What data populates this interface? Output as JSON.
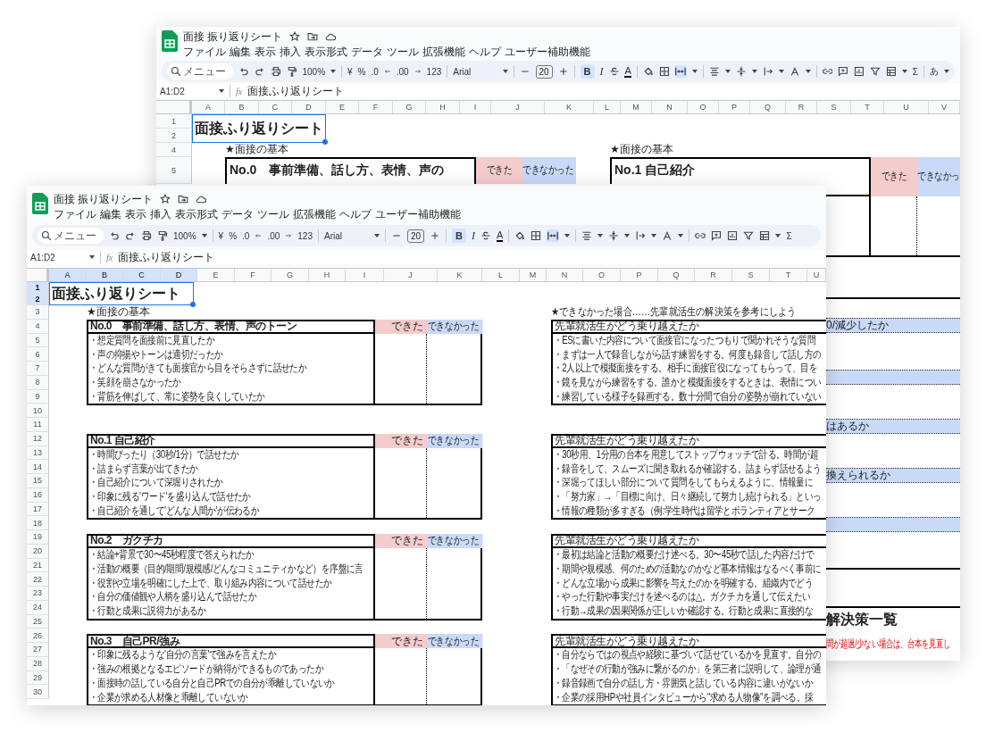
{
  "windows": [
    {
      "title": "面接 振り返りシート",
      "menu": [
        "ファイル",
        "編集",
        "表示",
        "挿入",
        "表示形式",
        "データ",
        "ツール",
        "拡張機能",
        "ヘルプ",
        "ユーザー補助機能"
      ],
      "toolbar": {
        "search_placeholder": "メニュー",
        "zoom": "100%",
        "currency": "¥",
        "percent": "%",
        "decimal_less": ".0",
        "decimal_more": ".00",
        "number_format": "123",
        "font": "Arial",
        "font_size": "20",
        "bold": "B",
        "italic": "I",
        "text_color": "A",
        "functions": "Σ",
        "input_tools": "あ",
        "bold_selected": true,
        "merge_selected": true
      },
      "name_box": "A1:D2",
      "fx": "fx",
      "formula": "面接ふり返りシート",
      "columns": [
        {
          "label": "A",
          "selected": false
        },
        {
          "label": "B",
          "selected": false
        },
        {
          "label": "C",
          "selected": false
        },
        {
          "label": "D",
          "selected": false
        },
        {
          "label": "E",
          "selected": false
        },
        {
          "label": "F",
          "selected": false
        },
        {
          "label": "G",
          "selected": false
        },
        {
          "label": "H",
          "selected": false
        },
        {
          "label": "I",
          "selected": false
        },
        {
          "label": "J",
          "selected": false
        },
        {
          "label": "K",
          "selected": false
        },
        {
          "label": "L",
          "selected": false
        },
        {
          "label": "M",
          "selected": false
        },
        {
          "label": "N",
          "selected": false
        },
        {
          "label": "O",
          "selected": false
        },
        {
          "label": "P",
          "selected": false
        },
        {
          "label": "Q",
          "selected": false
        },
        {
          "label": "R",
          "selected": false
        },
        {
          "label": "S",
          "selected": false
        },
        {
          "label": "T",
          "selected": false
        },
        {
          "label": "U",
          "selected": false
        },
        {
          "label": "V",
          "selected": false
        }
      ],
      "rows": [
        {
          "label": "1",
          "selected": false
        },
        {
          "label": "2",
          "selected": false
        },
        {
          "label": "4",
          "selected": false
        },
        {
          "label": "5",
          "selected": false
        }
      ],
      "sheet": {
        "title": "面接ふり返りシート",
        "labels": [
          "★面接の基本",
          "★面接の基本"
        ],
        "blocks": [
          {
            "heading": "No.0　事前準備、話し方、表情、声の",
            "done": "できた",
            "not_done": "できなかった"
          },
          {
            "heading": "No.1  自己紹介",
            "done": "できた",
            "not_done": "できなかっ"
          }
        ],
        "bands": [
          {
            "kind": "band",
            "text": "0/減少したか"
          },
          {
            "kind": "band"
          },
          {
            "kind": "band",
            "text": "はあるか"
          },
          {
            "kind": "band",
            "text": "換えられるか"
          },
          {
            "kind": "band"
          }
        ],
        "summary_heading": "解決策一覧",
        "note": "間が超過/少ない場合は、台本を見直し"
      }
    },
    {
      "title": "面接 振り返りシート",
      "menu": [
        "ファイル",
        "編集",
        "表示",
        "挿入",
        "表示形式",
        "データ",
        "ツール",
        "拡張機能",
        "ヘルプ",
        "ユーザー補助機能"
      ],
      "toolbar": {
        "search_placeholder": "メニュー",
        "zoom": "100%",
        "currency": "¥",
        "percent": "%",
        "decimal_less": ".0",
        "decimal_more": ".00",
        "number_format": "123",
        "font": "Arial",
        "font_size": "20",
        "bold": "B",
        "italic": "I",
        "text_color": "A",
        "functions": "Σ",
        "bold_selected": true,
        "merge_selected": true
      },
      "name_box": "A1:D2",
      "fx": "fx",
      "formula": "面接ふり返りシート",
      "columns": [
        {
          "label": "A",
          "selected": true
        },
        {
          "label": "B",
          "selected": true
        },
        {
          "label": "C",
          "selected": true
        },
        {
          "label": "D",
          "selected": true
        },
        {
          "label": "E",
          "selected": false
        },
        {
          "label": "F",
          "selected": false
        },
        {
          "label": "G",
          "selected": false
        },
        {
          "label": "H",
          "selected": false
        },
        {
          "label": "I",
          "selected": false
        },
        {
          "label": "J",
          "selected": false
        },
        {
          "label": "K",
          "selected": false
        },
        {
          "label": "L",
          "selected": false
        },
        {
          "label": "M",
          "selected": false
        },
        {
          "label": "N",
          "selected": false
        },
        {
          "label": "O",
          "selected": false
        },
        {
          "label": "P",
          "selected": false
        },
        {
          "label": "Q",
          "selected": false
        },
        {
          "label": "R",
          "selected": false
        },
        {
          "label": "S",
          "selected": false
        },
        {
          "label": "T",
          "selected": false
        },
        {
          "label": "U",
          "selected": false
        }
      ],
      "rows": [
        {
          "label": "1",
          "selected": true
        },
        {
          "label": "2",
          "selected": true
        },
        {
          "label": "3",
          "selected": false
        },
        {
          "label": "4",
          "selected": false
        },
        {
          "label": "5",
          "selected": false
        },
        {
          "label": "6",
          "selected": false
        },
        {
          "label": "7",
          "selected": false
        },
        {
          "label": "8",
          "selected": false
        },
        {
          "label": "9",
          "selected": false
        },
        {
          "label": "10",
          "selected": false
        },
        {
          "label": "11",
          "selected": false
        },
        {
          "label": "12",
          "selected": false
        },
        {
          "label": "13",
          "selected": false
        },
        {
          "label": "14",
          "selected": false
        },
        {
          "label": "15",
          "selected": false
        },
        {
          "label": "16",
          "selected": false
        },
        {
          "label": "17",
          "selected": false
        },
        {
          "label": "18",
          "selected": false
        },
        {
          "label": "19",
          "selected": false
        },
        {
          "label": "20",
          "selected": false
        },
        {
          "label": "21",
          "selected": false
        },
        {
          "label": "22",
          "selected": false
        },
        {
          "label": "23",
          "selected": false
        },
        {
          "label": "24",
          "selected": false
        },
        {
          "label": "25",
          "selected": false
        },
        {
          "label": "26",
          "selected": false
        },
        {
          "label": "27",
          "selected": false
        },
        {
          "label": "28",
          "selected": false
        },
        {
          "label": "29",
          "selected": false
        },
        {
          "label": "30",
          "selected": false
        }
      ],
      "sheet": {
        "title": "面接ふり返りシート",
        "label": "★面接の基本",
        "right_label": "★できなかった場合……先輩就活生の解決策を参考にしよう",
        "blocks": [
          {
            "heading": "No.0　事前準備、話し方、表情、声のトーン",
            "done": "できた",
            "not_done": "できなかった",
            "items": [
              "・想定質問を面接前に見直したか",
              "・声の抑揚やトーンは適切だったか",
              "・どんな質問がきても面接官から目をそらさずに話せたか",
              "・笑顔を崩さなかったか",
              "・背筋を伸ばして、常に姿勢を良くしていたか"
            ]
          },
          {
            "heading": "No.1  自己紹介",
            "done": "できた",
            "not_done": "できなかった",
            "items": [
              "・時間ぴったり（30秒/1分）で話せたか",
              "・詰まらず言葉が出てきたか",
              "・自己紹介について深堀りされたか",
              "・印象に残る'ワード'を盛り込んで話せたか",
              "・自己紹介を通して'どんな人間か'が伝わるか"
            ]
          },
          {
            "heading": "No.2　ガクチカ",
            "done": "できた",
            "not_done": "できなかった",
            "items": [
              "・結論+背景で30〜45秒程度で答えられたか",
              "・活動の概要（目的/期間/規模感/どんなコミュニティかなど）を序盤に言",
              "・役割や立場を明確にした上で、取り組み内容について話せたか",
              "・自分の価値観や人柄を盛り込んで話せたか",
              "・行動と成果に説得力があるか"
            ]
          },
          {
            "heading": "No.3　自己PR/強み",
            "done": "できた",
            "not_done": "できなかった",
            "items": [
              "・印象に残るような'自分の言葉'で強みを言えたか",
              "・強みの根拠となるエピソードが納得ができるものであったか",
              "・面接時の話している自分と自己PRでの自分が乖離していないか",
              "・企業が求める人材像と乖離していないか"
            ]
          }
        ],
        "advice": [
          {
            "heading": "先輩就活生がどう乗り越えたか",
            "items": [
              "・ESに書いた内容について面接官になったつもりで聞かれそうな質問",
              "・まずは一人で録音しながら話す練習をする。何度も録音して話し方の",
              "・2人以上で模擬面接をする。相手に面接官役になってもらって、目を",
              "・鏡を見ながら練習をする。誰かと模擬面接をするときは、表情につい",
              "・練習している様子を録画する。数十分間で自分の姿勢が崩れていない"
            ]
          },
          {
            "heading": "先輩就活生がどう乗り越えたか",
            "items": [
              "・30秒用、1分用の台本を用意してストップウォッチで計る。時間が超",
              "・録音をして、スムーズに聞き取れるか確認する。詰まらず話せるよう",
              "・深堀ってほしい部分について質問をしてもらえるように、情報量に",
              "・「努力家」→「目標に向け、日々継続して努力し続けられる」といっ",
              "・情報の種類が多すぎる（例:学生時代は留学とボランティアとサーク"
            ]
          },
          {
            "heading": "先輩就活生がどう乗り越えたか",
            "items": [
              "・最初は結論と活動の概要だけ述べる。30〜45秒で話した内容だけで",
              "・期間や規模感、何のための活動なのかなど基本情報はなるべく事前に",
              "・どんな立場から成果に影響を与えたのかを明確する。組織内でどう",
              "・やった行動や事実だけを述べるのは△。ガクチカを通して伝えたい",
              "・行動→成果の因果関係が正しいか確認する。行動と成果に直接的な"
            ]
          },
          {
            "heading": "先輩就活生がどう乗り越えたか",
            "items": [
              "・自分ならではの視点や経験に基づいて話せているかを見直す。自分の",
              "・「なぜその行動が強みに繋がるのか」を第三者に説明して、論理が通",
              "・録音録画で自分の話し方・雰囲気と話している内容に違いがないか",
              "・企業の採用HPや社員インタビューから\"求める人物像\"を調べる。採"
            ]
          }
        ]
      }
    }
  ]
}
